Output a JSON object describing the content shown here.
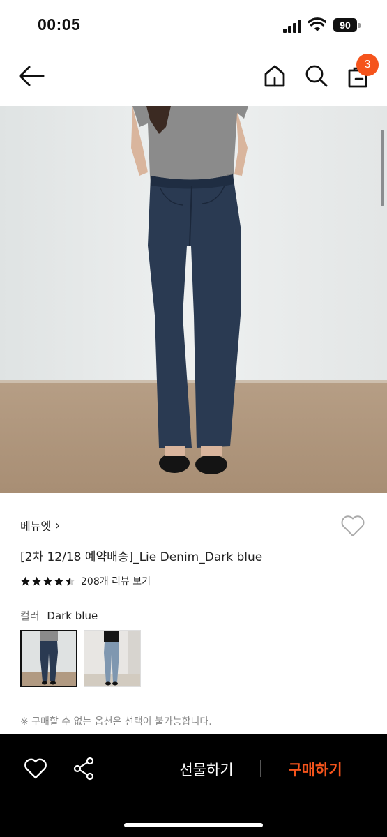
{
  "status_bar": {
    "time": "00:05",
    "battery": "90"
  },
  "nav": {
    "cart_count": "3",
    "icons": [
      "back-arrow-icon",
      "home-icon",
      "search-icon",
      "cart-icon"
    ]
  },
  "product": {
    "brand": "베뉴엣",
    "brand_chevron": "›",
    "title": "[2차 12/18 예약배송]_Lie Denim_Dark blue",
    "rating": 4.5,
    "reviews_label": "208개 리뷰 보기",
    "color_label": "컬러",
    "color_value": "Dark blue",
    "notice": "※ 구매할 수 없는 옵션은 선택이 불가능합니다."
  },
  "bottom_bar": {
    "gift_label": "선물하기",
    "buy_label": "구매하기"
  },
  "colors": {
    "accent": "#f5541c",
    "bottom_bar_bg": "#000000",
    "denim_dark": "#2a3a52",
    "denim_light": "#7f97b0"
  }
}
